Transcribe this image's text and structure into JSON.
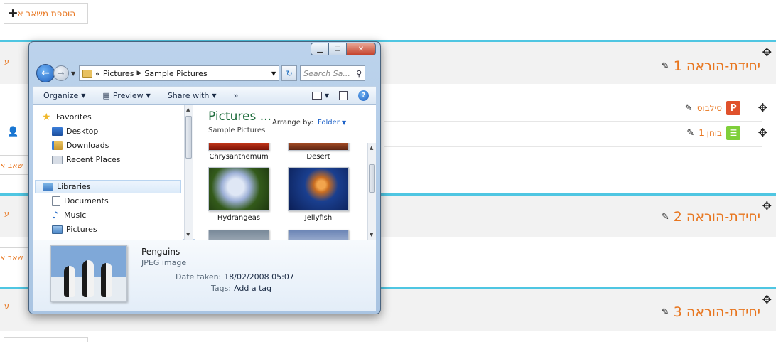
{
  "page": {
    "add_activity_label": "הוספת משאב א",
    "add_activity_partial": "שאב א",
    "left_cut_text": "ע",
    "sections": [
      {
        "title": "יחידת-הוראה 1"
      },
      {
        "title": "יחידת-הוראה 2"
      },
      {
        "title": "יחידת-הוראה 3"
      }
    ],
    "activities": [
      {
        "label": "סילבוס",
        "icon": "P"
      },
      {
        "label": "בוחן 1",
        "icon": "☰"
      }
    ],
    "colors": {
      "accent": "#e8761f",
      "section_border": "#4fc6e2"
    }
  },
  "explorer": {
    "address": {
      "prefix": "«",
      "crumbs": [
        "Pictures",
        "Sample Pictures"
      ]
    },
    "search_placeholder": "Search Sa...",
    "toolbar": {
      "organize": "Organize",
      "preview": "Preview",
      "share_with": "Share with",
      "more": "»"
    },
    "nav": {
      "favorites": "Favorites",
      "desktop": "Desktop",
      "downloads": "Downloads",
      "recent_places": "Recent Places",
      "libraries": "Libraries",
      "documents": "Documents",
      "music": "Music",
      "pictures": "Pictures"
    },
    "library": {
      "title": "Pictures ...",
      "subtitle": "Sample Pictures",
      "arrange_label": "Arrange by:",
      "arrange_value": "Folder"
    },
    "files": [
      {
        "name": "Chrysanthemum"
      },
      {
        "name": "Desert"
      },
      {
        "name": "Hydrangeas"
      },
      {
        "name": "Jellyfish"
      }
    ],
    "details": {
      "name": "Penguins",
      "type": "JPEG image",
      "date_label": "Date taken:",
      "date_value": "18/02/2008 05:07",
      "tags_label": "Tags:",
      "tags_value": "Add a tag"
    }
  }
}
